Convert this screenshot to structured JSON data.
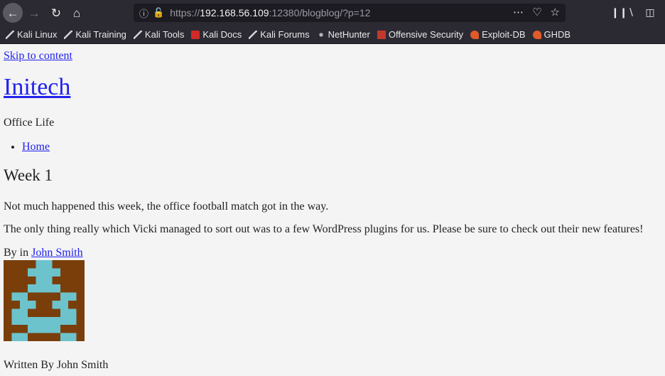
{
  "browser": {
    "url_scheme": "https://",
    "url_host": "192.168.56.109",
    "url_rest": ":12380/blogblog/?p=12",
    "bookmarks": [
      "Kali Linux",
      "Kali Training",
      "Kali Tools",
      "Kali Docs",
      "Kali Forums",
      "NetHunter",
      "Offensive Security",
      "Exploit-DB",
      "GHDB"
    ]
  },
  "page": {
    "skip_link": "Skip to content",
    "site_title": "Initech",
    "site_description": "Office Life",
    "menu": [
      "Home"
    ],
    "post_title": "Week 1",
    "paragraphs": [
      "Not much happened this week, the office football match got in the way.",
      "The only thing really which Vicki managed to sort out was to a few WordPress plugins for us. Please be sure to check out their new features!"
    ],
    "byline_prefix": "By in",
    "author": "John Smith",
    "written_by": "Written By John Smith"
  },
  "colors": {
    "avatar_bg": "#7a3e0b",
    "avatar_fg": "#6cc3cc",
    "link": "#2222ee"
  }
}
